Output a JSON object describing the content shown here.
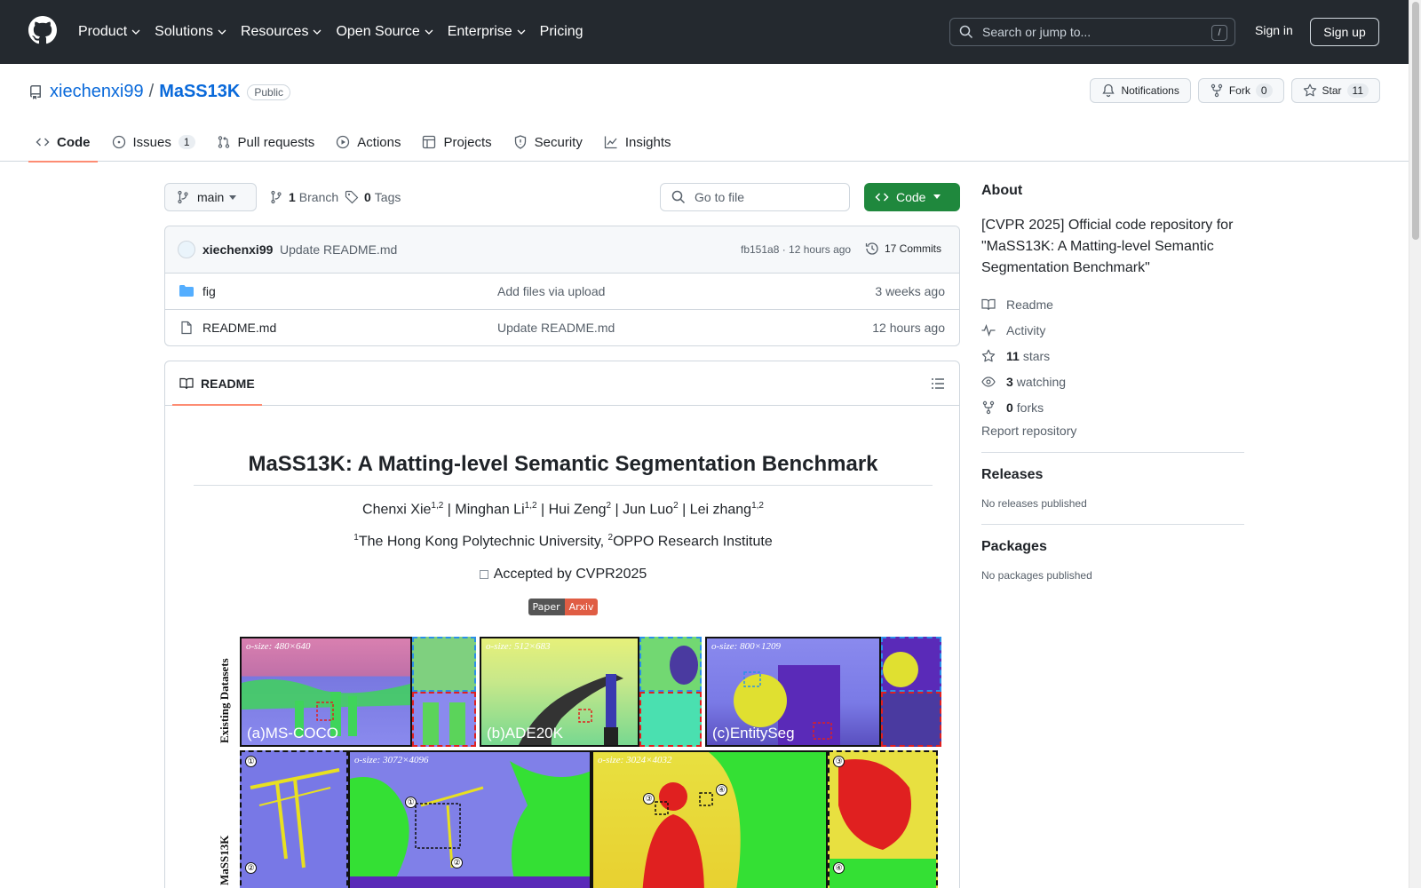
{
  "header": {
    "nav": [
      "Product",
      "Solutions",
      "Resources",
      "Open Source",
      "Enterprise",
      "Pricing"
    ],
    "search_placeholder": "Search or jump to...",
    "search_key": "/",
    "sign_in": "Sign in",
    "sign_up": "Sign up"
  },
  "repo": {
    "owner": "xiechenxi99",
    "separator": "/",
    "name": "MaSS13K",
    "visibility": "Public",
    "notifications_label": "Notifications",
    "fork_label": "Fork",
    "fork_count": "0",
    "star_label": "Star",
    "star_count": "11"
  },
  "tabs": [
    {
      "label": "Code",
      "icon": "code-icon"
    },
    {
      "label": "Issues",
      "icon": "issue-opened-icon",
      "count": "1"
    },
    {
      "label": "Pull requests",
      "icon": "git-pull-request-icon"
    },
    {
      "label": "Actions",
      "icon": "play-icon"
    },
    {
      "label": "Projects",
      "icon": "table-icon"
    },
    {
      "label": "Security",
      "icon": "shield-icon"
    },
    {
      "label": "Insights",
      "icon": "graph-icon"
    }
  ],
  "filebar": {
    "branch": "main",
    "branch_count": "1",
    "branch_label": "Branch",
    "tag_count": "0",
    "tag_label": "Tags",
    "goto_placeholder": "Go to file",
    "code_button": "Code"
  },
  "commit": {
    "author": "xiechenxi99",
    "message": "Update README.md",
    "hash_time": "fb151a8 · 12 hours ago",
    "commits_label": "17 Commits"
  },
  "files": [
    {
      "name": "fig",
      "type": "folder",
      "message": "Add files via upload",
      "time": "3 weeks ago"
    },
    {
      "name": "README.md",
      "type": "file",
      "message": "Update README.md",
      "time": "12 hours ago"
    }
  ],
  "readme": {
    "tab_label": "README",
    "title": "MaSS13K: A Matting-level Semantic Segmentation Benchmark",
    "authors": [
      {
        "name": "Chenxi Xie",
        "sup": "1,2"
      },
      {
        "name": "Minghan Li",
        "sup": "1,2"
      },
      {
        "name": "Hui Zeng",
        "sup": "2"
      },
      {
        "name": "Jun Luo",
        "sup": "2"
      },
      {
        "name": "Lei zhang",
        "sup": "1,2"
      }
    ],
    "author_sep": " | ",
    "aff1_sup": "1",
    "aff1": "The Hong Kong Polytechnic University, ",
    "aff2_sup": "2",
    "aff2": "OPPO Research Institute",
    "accepted": "Accepted by CVPR2025",
    "badge_left": "Paper",
    "badge_right": "Arxiv",
    "figure": {
      "row1_label": "Existing Datasets",
      "row2_label": "MaSS13K",
      "panels": [
        {
          "osize": "o-size: 480×640",
          "label": "(a)MS-COCO"
        },
        {
          "osize": "o-size: 512×683",
          "label": "(b)ADE20K"
        },
        {
          "osize": "o-size: 800×1209",
          "label": "(c)EntitySeg"
        },
        {
          "osize": "o-size: 3072×4096"
        },
        {
          "osize": "o-size: 3024×4032"
        }
      ],
      "markers": [
        "①",
        "②",
        "③",
        "④"
      ]
    }
  },
  "about": {
    "heading": "About",
    "description": "[CVPR 2025] Official code repository for \"MaSS13K: A Matting-level Semantic Segmentation Benchmark\"",
    "readme": "Readme",
    "activity": "Activity",
    "stars_count": "11",
    "stars_label": "stars",
    "watching_count": "3",
    "watching_label": "watching",
    "forks_count": "0",
    "forks_label": "forks",
    "report": "Report repository"
  },
  "releases": {
    "heading": "Releases",
    "text": "No releases published"
  },
  "packages": {
    "heading": "Packages",
    "text": "No packages published"
  },
  "colors": {
    "header_bg": "#24292f",
    "link": "#0969da",
    "primary_button": "#1f883d",
    "active_tab_underline": "#fd8c73",
    "badge_right": "#e05d44"
  }
}
